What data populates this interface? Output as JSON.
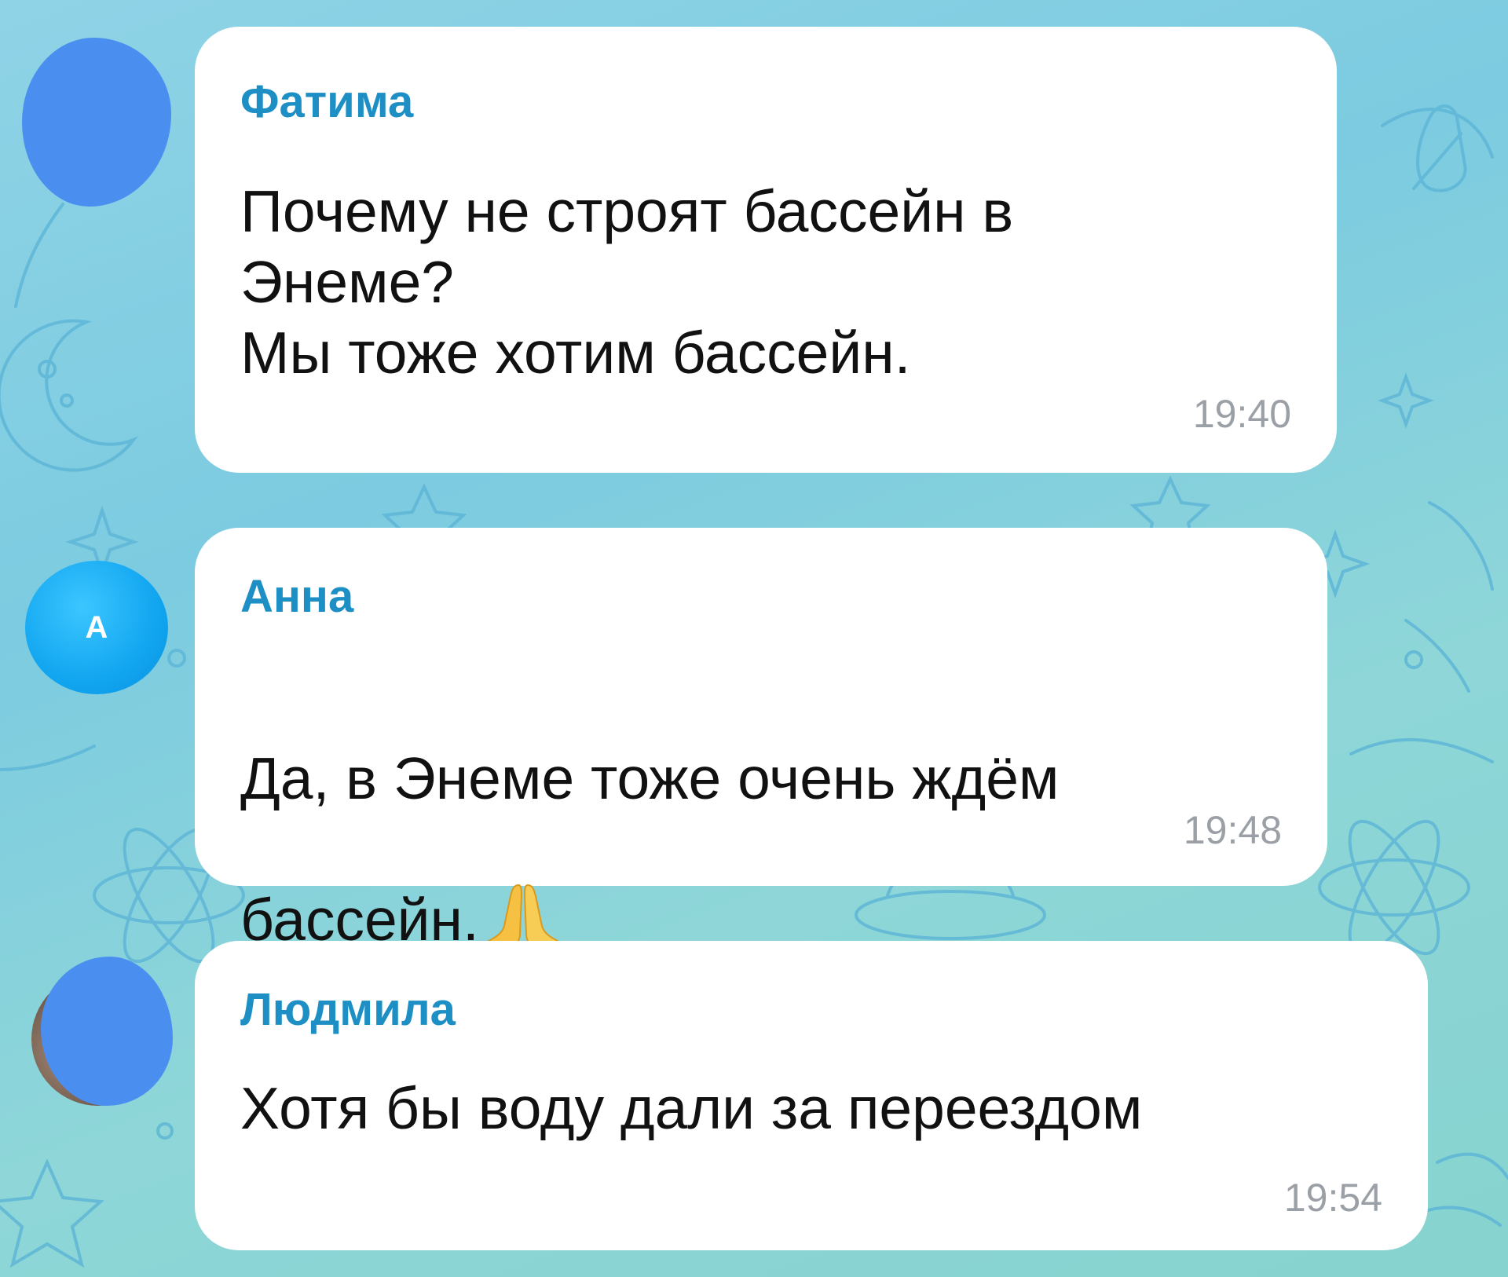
{
  "chat": {
    "messages": [
      {
        "sender": "Фатима",
        "text": "Почему не строят бассейн в\nЭнеме?\nМы тоже хотим бассейн.",
        "time": "19:40"
      },
      {
        "sender": "Анна",
        "avatar_letter": "А",
        "text_line1": "Да, в Энеме тоже очень ждём",
        "text_line2": "бассейн.",
        "emoji": "folded-hands",
        "time": "19:48"
      },
      {
        "sender": "Людмила",
        "text": "Хотя бы воду дали за переездом",
        "time": "19:54"
      }
    ]
  },
  "colors": {
    "sender_name": "#1d8fc4",
    "bubble": "#ffffff",
    "timestamp": "#9aa0a6",
    "redacted_avatar": "#4a8ef0",
    "wallpaper": "#8fd3e6"
  }
}
